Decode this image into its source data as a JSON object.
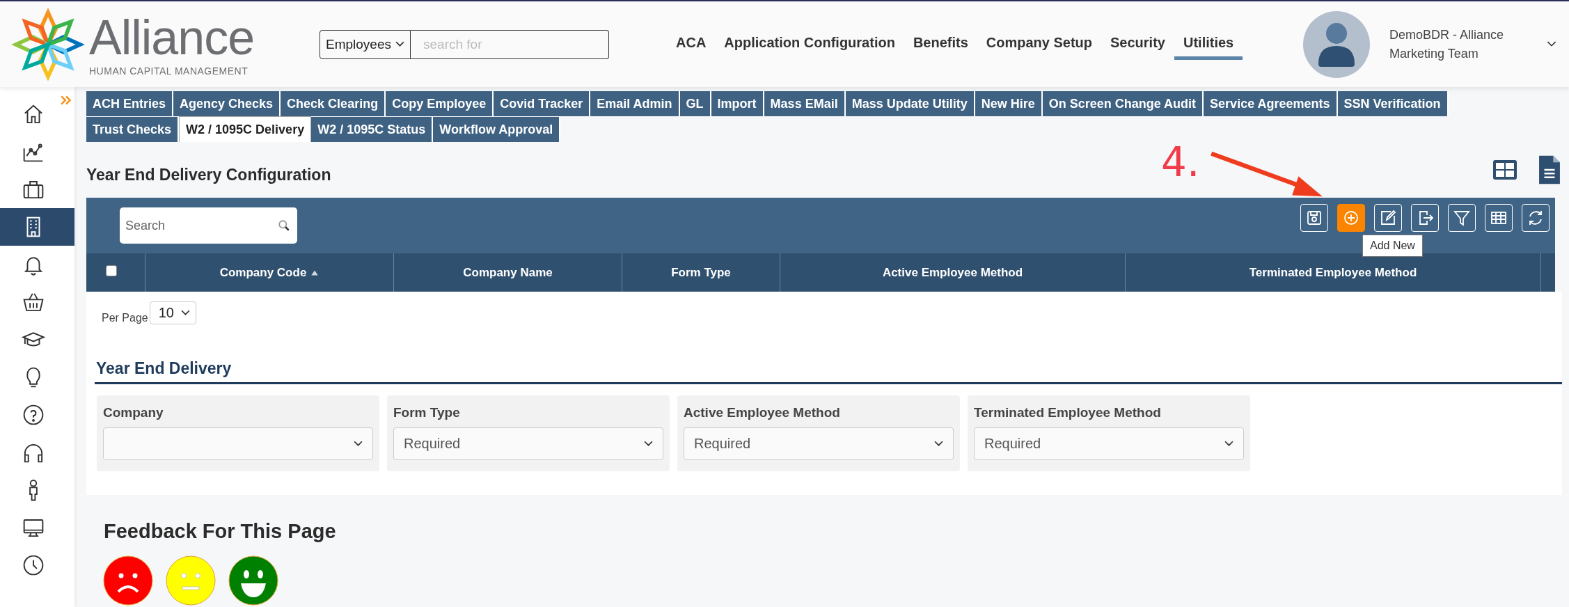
{
  "header": {
    "logo": {
      "name": "Alliance",
      "tagline": "HUMAN CAPITAL MANAGEMENT"
    },
    "search": {
      "scope": "Employees",
      "placeholder": "search for"
    },
    "nav": [
      {
        "label": "ACA",
        "selected": false
      },
      {
        "label": "Application Configuration",
        "selected": false
      },
      {
        "label": "Benefits",
        "selected": false
      },
      {
        "label": "Company Setup",
        "selected": false
      },
      {
        "label": "Security",
        "selected": false
      },
      {
        "label": "Utilities",
        "selected": true
      }
    ],
    "user": {
      "name_lines": [
        "DemoBDR - Alliance",
        "Marketing Team"
      ]
    }
  },
  "sidebar": {
    "items": [
      {
        "selected": false
      },
      {
        "selected": false
      },
      {
        "selected": false
      },
      {
        "selected": true
      },
      {
        "selected": false
      },
      {
        "selected": false
      },
      {
        "selected": false
      },
      {
        "selected": false
      },
      {
        "selected": false
      },
      {
        "selected": false
      },
      {
        "selected": false
      },
      {
        "selected": false
      },
      {
        "selected": false
      }
    ]
  },
  "tab_rows": [
    [
      {
        "label": "ACH Entries",
        "selected": false
      },
      {
        "label": "Agency Checks",
        "selected": false
      },
      {
        "label": "Check Clearing",
        "selected": false
      },
      {
        "label": "Copy Employee",
        "selected": false
      },
      {
        "label": "Covid Tracker",
        "selected": false
      },
      {
        "label": "Email Admin",
        "selected": false
      },
      {
        "label": "GL",
        "selected": false
      },
      {
        "label": "Import",
        "selected": false
      },
      {
        "label": "Mass EMail",
        "selected": false
      },
      {
        "label": "Mass Update Utility",
        "selected": false
      },
      {
        "label": "New Hire",
        "selected": false
      },
      {
        "label": "On Screen Change Audit",
        "selected": false
      },
      {
        "label": "Service Agreements",
        "selected": false
      },
      {
        "label": "SSN Verification",
        "selected": false
      }
    ],
    [
      {
        "label": "Trust Checks",
        "selected": false
      },
      {
        "label": "W2 / 1095C Delivery",
        "selected": true
      },
      {
        "label": "W2 / 1095C Status",
        "selected": false
      },
      {
        "label": "Workflow Approval",
        "selected": false
      }
    ]
  ],
  "page_title": "Year End Delivery Configuration",
  "annotation": {
    "label": "4."
  },
  "grid": {
    "search": {
      "placeholder": "Search"
    },
    "toolbar": [
      {
        "highlighted": false
      },
      {
        "highlighted": true
      },
      {
        "highlighted": false
      },
      {
        "highlighted": false
      },
      {
        "highlighted": false
      },
      {
        "highlighted": false
      },
      {
        "highlighted": false
      }
    ],
    "tooltip": "Add New",
    "select_all": {
      "checked": false
    },
    "columns": [
      {
        "label": "Company Code",
        "sorted_ascending": true
      },
      {
        "label": "Company Name",
        "sorted_ascending": false
      },
      {
        "label": "Form Type",
        "sorted_ascending": false
      },
      {
        "label": "Active Employee Method",
        "sorted_ascending": false
      },
      {
        "label": "Terminated Employee Method",
        "sorted_ascending": false
      }
    ],
    "per_page": {
      "label": "Per Page",
      "value": "10"
    }
  },
  "form": {
    "title": "Year End Delivery",
    "fields": [
      {
        "label": "Company"
      },
      {
        "label": "Form Type",
        "value": "Required"
      },
      {
        "label": "Active Employee Method",
        "value": "Required"
      },
      {
        "label": "Terminated Employee Method",
        "value": "Required"
      }
    ]
  },
  "feedback": {
    "title": "Feedback For This Page",
    "faces": [
      {
        "kind": "sad",
        "color": "#ff0000"
      },
      {
        "kind": "neutral",
        "color": "#ffff00"
      },
      {
        "kind": "happy",
        "color": "#008000"
      }
    ]
  }
}
